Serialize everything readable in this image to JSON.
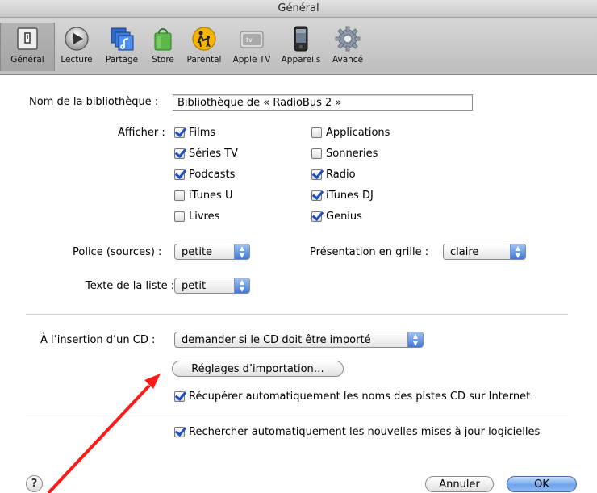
{
  "window": {
    "title": "Général"
  },
  "toolbar": {
    "items": [
      {
        "label": "Général",
        "icon": "general-switch-icon",
        "selected": true
      },
      {
        "label": "Lecture",
        "icon": "play-icon",
        "selected": false
      },
      {
        "label": "Partage",
        "icon": "music-share-icon",
        "selected": false
      },
      {
        "label": "Store",
        "icon": "shopping-bag-icon",
        "selected": false
      },
      {
        "label": "Parental",
        "icon": "parental-icon",
        "selected": false
      },
      {
        "label": "Apple TV",
        "icon": "appletv-icon",
        "selected": false
      },
      {
        "label": "Appareils",
        "icon": "ipod-icon",
        "selected": false
      },
      {
        "label": "Avancé",
        "icon": "gear-icon",
        "selected": false
      }
    ],
    "apple_tv_badge": "tv"
  },
  "library": {
    "label": "Nom de la bibliothèque :",
    "value": "Bibliothèque de « RadioBus 2 »"
  },
  "show": {
    "label": "Afficher :",
    "left": [
      {
        "label": "Films",
        "checked": true
      },
      {
        "label": "Séries TV",
        "checked": true
      },
      {
        "label": "Podcasts",
        "checked": true
      },
      {
        "label": "iTunes U",
        "checked": false
      },
      {
        "label": "Livres",
        "checked": false
      }
    ],
    "right": [
      {
        "label": "Applications",
        "checked": false
      },
      {
        "label": "Sonneries",
        "checked": false
      },
      {
        "label": "Radio",
        "checked": true
      },
      {
        "label": "iTunes DJ",
        "checked": true
      },
      {
        "label": "Genius",
        "checked": true
      }
    ]
  },
  "source_font": {
    "label": "Police (sources) :",
    "value": "petite"
  },
  "grid": {
    "label": "Présentation en grille :",
    "value": "claire"
  },
  "list_text": {
    "label": "Texte de la liste :",
    "value": "petit"
  },
  "cd_insert": {
    "label": "À l’insertion d’un CD :",
    "value": "demander si le CD doit être importé"
  },
  "import_settings_button": "Réglages d’importation…",
  "auto_track_names": {
    "label": "Récupérer automatiquement les noms des pistes CD sur Internet",
    "checked": true
  },
  "auto_updates": {
    "label": "Rechercher automatiquement les nouvelles mises à jour logicielles",
    "checked": true
  },
  "footer": {
    "help": "?",
    "cancel": "Annuler",
    "ok": "OK"
  },
  "colors": {
    "annotation_arrow": "#ff1a1a",
    "checkmark": "#1e4fbf",
    "default_button": "#6ea3ea"
  }
}
